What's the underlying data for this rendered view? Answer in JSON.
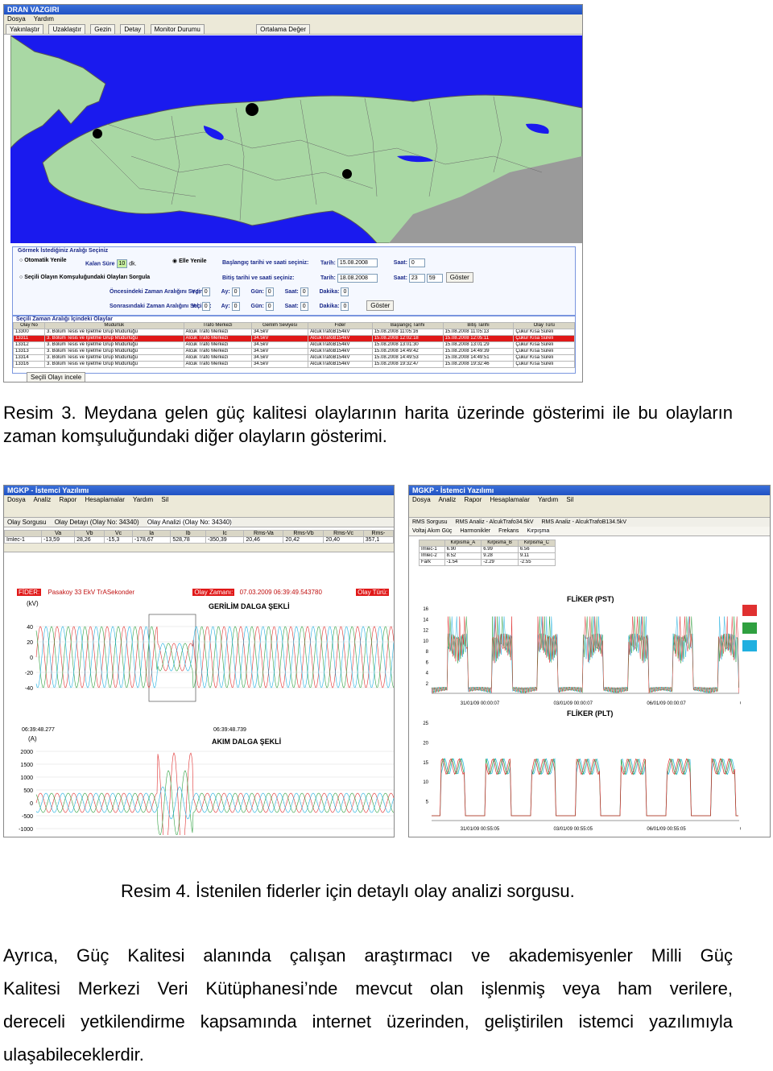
{
  "fig3": {
    "window_title": "DRAN VAZGIRI",
    "menu": [
      "Dosya",
      "Yardım"
    ],
    "toolbar": [
      "Yakınlaştır",
      "Uzaklaştır",
      "Gezin",
      "Detay",
      "Monitor Durumu",
      "Ortalama Değer"
    ],
    "interval_panel": {
      "title": "Görmek İstediğiniz Aralığı Seçiniz",
      "auto_label": "Otomatik Yenile",
      "sure_label": "Kalan Süre",
      "sure_value": "10",
      "sure_unit": "dk.",
      "manual_label": "Elle Yenile",
      "start_label": "Başlangıç tarihi ve saati seçiniz:",
      "end_label": "Bitiş tarihi ve saati seçiniz:",
      "tarih_label": "Tarih:",
      "saat_label": "Saat:",
      "start_date": "15.08.2008",
      "end_date": "18.08.2008",
      "start_hour": "0",
      "end_hour": "23",
      "end_min": "59",
      "goster": "Göster",
      "neighbor_label": "Seçili Olayın Komşuluğundaki Olayları Sorgula",
      "before_label": "Öncesindeki Zaman Aralığını Seçiniz:",
      "after_label": "Sonrasındaki Zaman Aralığını Seçiniz:",
      "yil": "Yıl:",
      "ay": "Ay:",
      "gun": "Gün:",
      "saat2": "Saat:",
      "dakika": "Dakika:",
      "zero": "0",
      "goster2": "Göster"
    },
    "events": {
      "title": "Seçili Zaman Aralığı İçindeki Olaylar",
      "columns": [
        "Olay No",
        "Müdürlük",
        "Trafo Merkezi",
        "Gerilim Seviyesi",
        "Fider",
        "Başlangıç Tarihi",
        "Bitiş Tarihi",
        "Olay Türü"
      ],
      "rows": [
        [
          "13300",
          "3. Bölüm Tesis ve İşletme Grup Müdürlüğü",
          "Alcuk Trafo Merkezi",
          "34.5kV",
          "AlcukTrafoB154kV",
          "15.08.2008 11:05:16",
          "15.08.2008 11:05:13",
          "Çukur Kısa Süreli"
        ],
        [
          "13311",
          "3. Bölüm Tesis ve İşletme Grup Müdürlüğü",
          "Alcuk Trafo Merkezi",
          "34.5kV",
          "AlcukTrafoB154kV",
          "15.08.2008 12:02:18",
          "15.08.2008 12:05:11",
          "Çukur Kısa Süreli"
        ],
        [
          "13312",
          "3. Bölüm Tesis ve İşletme Grup Müdürlüğü",
          "Alcuk Trafo Merkezi",
          "34.5kV",
          "AlcukTrafoB154kV",
          "15.08.2008 13:01:30",
          "15.08.2008 13:01:29",
          "Çukur Kısa Süreli"
        ],
        [
          "13313",
          "3. Bölüm Tesis ve İşletme Grup Müdürlüğü",
          "Alcuk Trafo Merkezi",
          "34.5kV",
          "AlcukTrafoB154kV",
          "15.08.2008 14:49:42",
          "15.08.2008 14:49:39",
          "Çukur Kısa Süreli"
        ],
        [
          "13314",
          "3. Bölüm Tesis ve İşletme Grup Müdürlüğü",
          "Alcuk Trafo Merkezi",
          "34.5kV",
          "AlcukTrafoB154kV",
          "15.08.2008 14:49:53",
          "15.08.2008 14:49:51",
          "Çukur Kısa Süreli"
        ],
        [
          "13316",
          "3. Bölüm Tesis ve İşletme Grup Müdürlüğü",
          "Alcuk Trafo Merkezi",
          "34.5kV",
          "AlcukTrafoB154kV",
          "15.08.2008 19:32:47",
          "15.08.2008 19:32:46",
          "Çukur Kısa Süreli"
        ]
      ]
    },
    "bottom_button": "Seçili Olayı incele"
  },
  "caption3": "Resim 3. Meydana gelen güç kalitesi olaylarının harita üzerinde gösterimi ile bu olayların zaman komşuluğundaki diğer olayların gösterimi.",
  "fig4a": {
    "window_title": "MGKP - İstemci Yazılımı",
    "menu": [
      "Dosya",
      "Analiz",
      "Rapor",
      "Hesaplamalar",
      "Yardım",
      "Sil"
    ],
    "tabs": [
      "Olay Sorgusu",
      "Olay Detayı (Olay No: 34340)",
      "Olay Analizi (Olay No: 34340)"
    ],
    "table_headers": [
      "Va",
      "Vb",
      "Vc",
      "Ia",
      "Ib",
      "Ic",
      "Rms-Va",
      "Rms-Vb",
      "Rms-Vc",
      "Rms-"
    ],
    "row_label": "İmlec-1",
    "row_values": [
      "-13,59",
      "28,26",
      "-15,3",
      "-178,67",
      "528,78",
      "-350,39",
      "20,46",
      "20,42",
      "20,40",
      "357,1"
    ],
    "fider_label": "FİDER:",
    "fider_value": "Pasakoy 33 EkV TrASekonder",
    "olay_zamani_label": "Olay Zamanı:",
    "olay_zamani": "07.03.2009 06:39:49.543780",
    "olay_turu_label": "Olay Türü:",
    "kv_unit": "(kV)",
    "a_unit": "(A)",
    "voltage_title": "GERİLİM DALGA ŞEKLİ",
    "current_title": "AKIM DALGA ŞEKLİ",
    "v_ticks": [
      "40",
      "20",
      "0",
      "-20",
      "-40"
    ],
    "i_ticks": [
      "2000",
      "1500",
      "1000",
      "500",
      "0",
      "-500",
      "-1000"
    ],
    "t_start": "06:39:48.277",
    "t_end": "06:39:48.739"
  },
  "fig4b": {
    "window_title": "MGKP - İstemci Yazılımı",
    "menu": [
      "Dosya",
      "Analiz",
      "Rapor",
      "Hesaplamalar",
      "Yardım",
      "Sil"
    ],
    "tabs": [
      "RMS Sorgusu",
      "RMS Analiz - AlcukTrafo34.5kV",
      "RMS Analiz - AlcukTrafoB134.5kV"
    ],
    "subtabs": [
      "Voltaj Akım Güç",
      "Harmonikler",
      "Frekans",
      "Kırpışma"
    ],
    "table_headers": [
      "Kirpisma_A",
      "Kirpisma_B",
      "Kirpisma_C"
    ],
    "table_rows": [
      [
        "İmlec-1",
        "6.90",
        "6.99",
        "6.56"
      ],
      [
        "İmlec-2",
        "8.52",
        "9.28",
        "9.11"
      ],
      [
        "Fark",
        "-1.54",
        "-2.29",
        "-2.55"
      ]
    ],
    "pst_title": "FLİKER (PST)",
    "plt_title": "FLİKER (PLT)",
    "pst_ticks": [
      "16",
      "14",
      "12",
      "10",
      "8",
      "6",
      "4",
      "2"
    ],
    "plt_ticks": [
      "25",
      "20",
      "15",
      "10",
      "5"
    ],
    "pst_dates": [
      "31/01/09 00:00:07",
      "03/01/09 00:00:07",
      "06/01/09 00:00:07",
      "07/01/09 00:00:07"
    ],
    "plt_dates": [
      "31/01/09 00:55:05",
      "03/01/09 00:55:05",
      "06/01/09 00:55:05",
      "07/01/09 00:55:05"
    ]
  },
  "caption4": "Resim 4. İstenilen fiderler için detaylı olay analizi sorgusu.",
  "paragraph": {
    "line1": "Ayrıca, Güç Kalitesi alanında çalışan araştırmacı ve akademisyenler Milli Güç",
    "line2": "Kalitesi Merkezi Veri Kütüphanesi’nde mevcut olan işlenmiş veya ham verilere,",
    "line3": "dereceli yetkilendirme kapsamında internet üzerinden, geliştirilen istemci yazılımıyla",
    "line4": "ulaşabileceklerdir."
  },
  "colors": {
    "sea": "#1a1aee",
    "land": "#a9d8a4",
    "selected_row": "#e01818",
    "phase_a": "#e03030",
    "phase_b": "#30a040",
    "phase_c": "#20b0e0"
  }
}
